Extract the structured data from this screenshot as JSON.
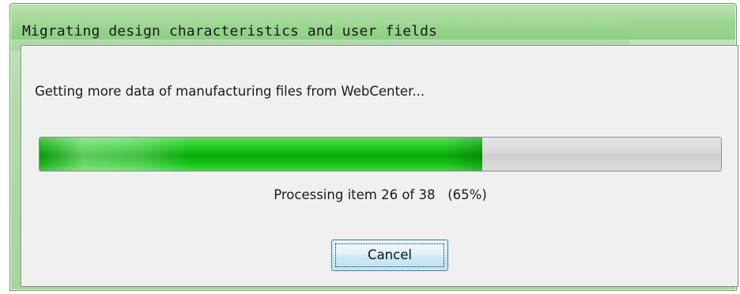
{
  "window": {
    "title": "Migrating design characteristics and user fields"
  },
  "dialog": {
    "message": "Getting more data of manufacturing files from WebCenter...",
    "progress": {
      "current": 26,
      "total": 38,
      "percent": 65,
      "fraction": 0.65,
      "status_text": "Processing item 26 of 38   (65%)"
    },
    "cancel_label": "Cancel"
  },
  "colors": {
    "progress_fill": "#1fc81f",
    "title_bar": "#9bd690",
    "client_background": "#f0f0f0",
    "button_border": "#3c7fb1"
  }
}
